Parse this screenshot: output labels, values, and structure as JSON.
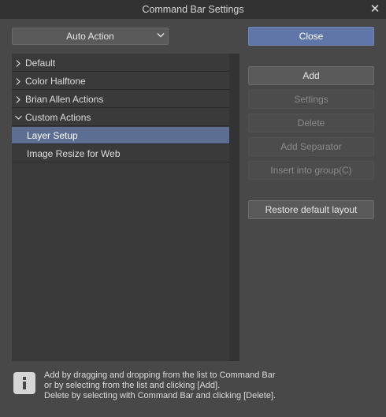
{
  "window": {
    "title": "Command Bar Settings",
    "close_glyph": "✕"
  },
  "dropdown": {
    "value": "Auto Action"
  },
  "list": {
    "groups": [
      {
        "label": "Default",
        "expanded": false
      },
      {
        "label": "Color Halftone",
        "expanded": false
      },
      {
        "label": "Brian Allen Actions",
        "expanded": false
      },
      {
        "label": "Custom Actions",
        "expanded": true
      }
    ],
    "children": [
      {
        "label": "Layer Setup",
        "selected": true
      },
      {
        "label": "Image Resize for Web",
        "selected": false
      }
    ]
  },
  "buttons": {
    "close": "Close",
    "add": "Add",
    "settings": "Settings",
    "delete": "Delete",
    "add_separator": "Add Separator",
    "insert_into_group": "Insert into group(C)",
    "restore_default": "Restore default layout"
  },
  "help": {
    "line1": "Add by dragging and dropping from the list to Command Bar",
    "line2": "or by selecting from the list and clicking [Add].",
    "line3": "Delete by selecting with Command Bar and clicking [Delete]."
  },
  "icons": {
    "close": "close-icon",
    "dropdown": "chevron-down-icon",
    "collapsed": "chevron-right-icon",
    "expanded": "chevron-down-icon",
    "info": "info-icon"
  },
  "colors": {
    "accent": "#6076a8",
    "selection": "#5c6e92",
    "background": "#484848"
  }
}
